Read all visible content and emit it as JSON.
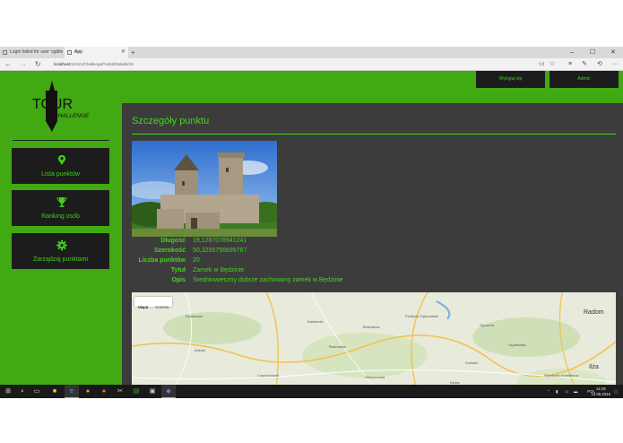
{
  "browser": {
    "tabs": [
      {
        "title": "Login failed for user 'sgible",
        "active": false
      },
      {
        "title": "App",
        "active": true
      }
    ],
    "address": {
      "host": "localhost",
      "path": ":52421/ChallengePoints/Details/18"
    }
  },
  "app": {
    "logo": {
      "main": "TOUR",
      "sub": "CHALLENGE"
    },
    "nav": [
      {
        "label": "Lista punktów",
        "icon": "map-marker-icon"
      },
      {
        "label": "Ranking osób",
        "icon": "trophy-icon"
      },
      {
        "label": "Zarządzaj punktami",
        "icon": "gear-icon"
      }
    ],
    "header": {
      "logout_label": "Wyloguj się",
      "user_label": "Admin"
    },
    "page_title": "Szczegóły punktu",
    "details": [
      {
        "label": "Długość",
        "value": "19,1287078941241"
      },
      {
        "label": "Szerokość",
        "value": "50,3255756699767"
      },
      {
        "label": "Liczba punktów",
        "value": "20"
      },
      {
        "label": "Tytuł",
        "value": "Zamek w Będzinie"
      },
      {
        "label": "Opis",
        "value": "Średniowieczny dobrze zachowany zamek w Będzinie"
      }
    ],
    "map": {
      "tabs": [
        "Mapa",
        "Satelita"
      ],
      "places": [
        "Dzialoszyn",
        "Kamiensk",
        "Belchatów",
        "Piotrków Trybunalski",
        "Opoczno",
        "Radom",
        "Wieluń",
        "Radomsko",
        "Końskie",
        "Skarżysko-Kamienna",
        "Kielce",
        "Częstochowa",
        "Włoszczowa",
        "Szydłowiec",
        "Ilża"
      ]
    }
  },
  "taskbar": {
    "tray": {
      "lang": "POL",
      "time": "14:29",
      "date": "14.05.2016"
    }
  },
  "colors": {
    "accent": "#41a912",
    "text_green": "#46d41c",
    "panel_dark": "#1c1c1c",
    "content_bg": "#3c3c3c"
  }
}
